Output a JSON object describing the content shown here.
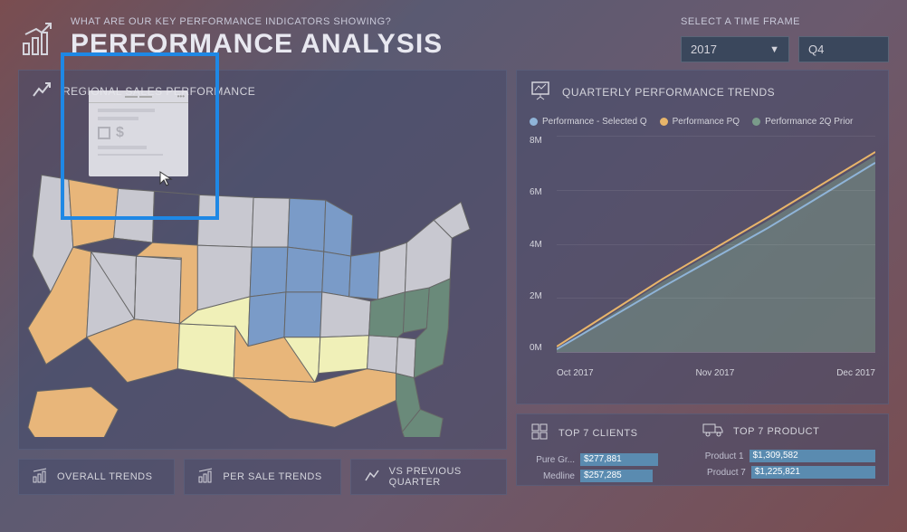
{
  "header": {
    "subtitle": "WHAT ARE OUR KEY PERFORMANCE INDICATORS SHOWING?",
    "title": "PERFORMANCE ANALYSIS",
    "time_frame_label": "SELECT A TIME FRAME",
    "year_value": "2017",
    "quarter_value": "Q4"
  },
  "panels": {
    "map_title": "REGIONAL SALES PERFORMANCE",
    "trends_title": "QUARTERLY PERFORMANCE TRENDS",
    "top_clients_title": "TOP 7 CLIENTS",
    "top_products_title": "TOP 7 PRODUCT",
    "overall_trends": "OVERALL TRENDS",
    "per_sale_trends": "PER SALE TRENDS",
    "vs_previous": "VS PREVIOUS QUARTER"
  },
  "legend": {
    "series1": "Performance - Selected Q",
    "series2": "Performance PQ",
    "series3": "Performance 2Q Prior"
  },
  "colors": {
    "series1": "#8fb4d8",
    "series2": "#e8b56a",
    "series3": "#7a9b8a",
    "map_orange": "#e8b67a",
    "map_blue": "#7a9bc8",
    "map_yellow": "#f0f0b8",
    "map_green": "#6a8a7a",
    "map_grey": "#c8c8d0"
  },
  "chart_data": {
    "type": "area",
    "title": "QUARTERLY PERFORMANCE TRENDS",
    "ylabel": "",
    "xlabel": "",
    "ylim": [
      0,
      8000000
    ],
    "y_ticks": [
      "0M",
      "2M",
      "4M",
      "6M",
      "8M"
    ],
    "x_ticks": [
      "Oct 2017",
      "Nov 2017",
      "Dec 2017"
    ],
    "series": [
      {
        "name": "Performance - Selected Q",
        "color": "#8fb4d8",
        "values": [
          100000,
          2400000,
          4600000,
          7000000
        ]
      },
      {
        "name": "Performance PQ",
        "color": "#e8b56a",
        "values": [
          200000,
          2700000,
          5000000,
          7400000
        ]
      },
      {
        "name": "Performance 2Q Prior",
        "color": "#7a9b8a",
        "values": [
          150000,
          2550000,
          4800000,
          7200000
        ]
      }
    ]
  },
  "top_clients": [
    {
      "label": "Pure Gr...",
      "value_text": "$277,881",
      "width_pct": 45
    },
    {
      "label": "Medline",
      "value_text": "$257,285",
      "width_pct": 42
    }
  ],
  "top_products": [
    {
      "label": "Product 1",
      "value_text": "$1,309,582",
      "width_pct": 80
    },
    {
      "label": "Product 7",
      "value_text": "$1,225,821",
      "width_pct": 75
    }
  ]
}
